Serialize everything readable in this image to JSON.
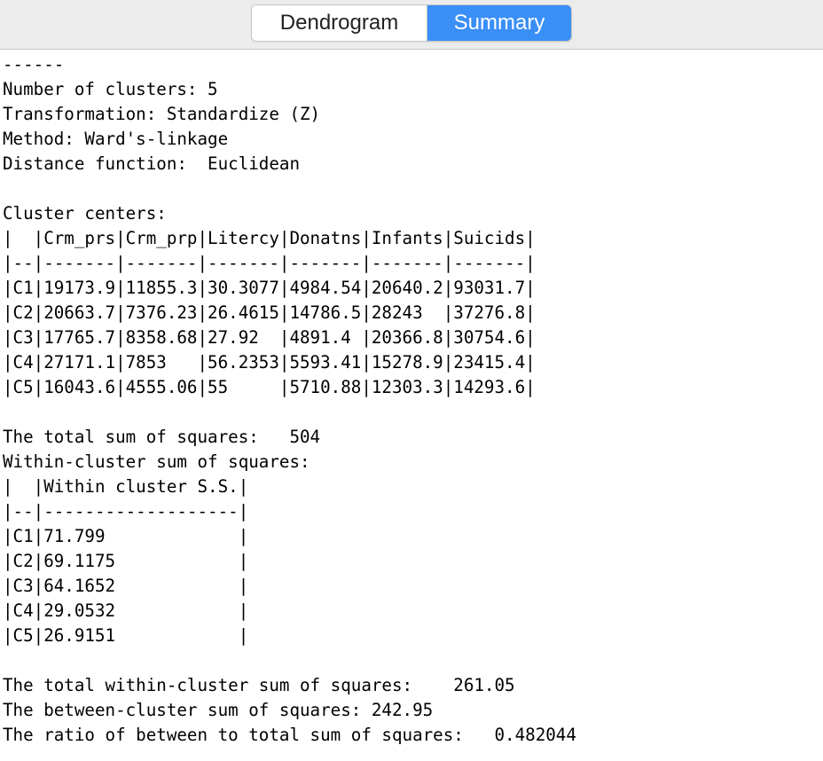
{
  "tabs": {
    "dendrogram_label": "Dendrogram",
    "summary_label": "Summary",
    "active": "Summary"
  },
  "summary": {
    "text": "------\nNumber of clusters: 5\nTransformation: Standardize (Z)\nMethod: Ward's-linkage\nDistance function:  Euclidean\n\nCluster centers:\n|  |Crm_prs|Crm_prp|Litercy|Donatns|Infants|Suicids|\n|--|-------|-------|-------|-------|-------|-------|\n|C1|19173.9|11855.3|30.3077|4984.54|20640.2|93031.7|\n|C2|20663.7|7376.23|26.4615|14786.5|28243  |37276.8|\n|C3|17765.7|8358.68|27.92  |4891.4 |20366.8|30754.6|\n|C4|27171.1|7853   |56.2353|5593.41|15278.9|23415.4|\n|C5|16043.6|4555.06|55     |5710.88|12303.3|14293.6|\n\nThe total sum of squares:   504\nWithin-cluster sum of squares:\n|  |Within cluster S.S.|\n|--|-------------------|\n|C1|71.799             |\n|C2|69.1175            |\n|C3|64.1652            |\n|C4|29.0532            |\n|C5|26.9151            |\n\nThe total within-cluster sum of squares:    261.05\nThe between-cluster sum of squares: 242.95\nThe ratio of between to total sum of squares:   0.482044"
  },
  "colors": {
    "accent": "#3a8ff6",
    "toolbar_bg": "#ececec"
  }
}
